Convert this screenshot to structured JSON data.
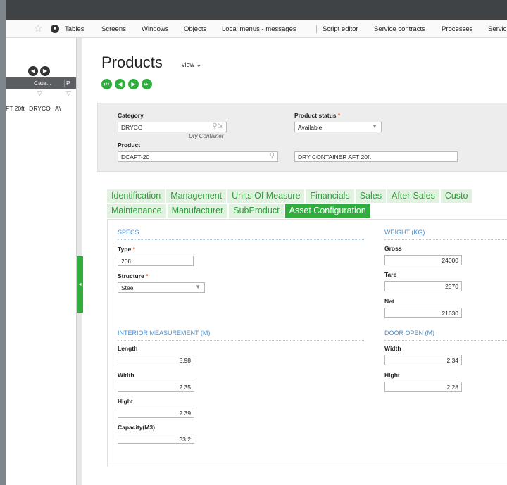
{
  "menu": {
    "items": [
      "Tables",
      "Screens",
      "Windows",
      "Objects",
      "Local menus - messages",
      "Script editor",
      "Service contracts",
      "Processes",
      "Servic"
    ]
  },
  "left_panel": {
    "columns": [
      "Cate...",
      "P"
    ],
    "row": {
      "col1": "FT 20ft",
      "col2": "DRYCO",
      "col3": "A\\"
    }
  },
  "page": {
    "title": "Products",
    "view_label": "view"
  },
  "header": {
    "category_label": "Category",
    "category_value": "DRYCO",
    "category_hint": "Dry Container",
    "product_status_label": "Product status",
    "product_status_value": "Available",
    "product_label": "Product",
    "product_value": "DCAFT-20",
    "product_description": "DRY CONTAINER AFT 20ft"
  },
  "tabs": {
    "row1": [
      "Identification",
      "Management",
      "Units Of Measure",
      "Financials",
      "Sales",
      "After-Sales",
      "Custo"
    ],
    "row2": [
      "Maintenance",
      "Manufacturer",
      "SubProduct",
      "Asset Configuration"
    ],
    "active": "Asset Configuration"
  },
  "specs": {
    "title": "SPECS",
    "type_label": "Type",
    "type_value": "20ft",
    "structure_label": "Structure",
    "structure_value": "Steel"
  },
  "weight": {
    "title": "WEIGHT (KG)",
    "gross_label": "Gross",
    "gross_value": "24000",
    "tare_label": "Tare",
    "tare_value": "2370",
    "net_label": "Net",
    "net_value": "21630"
  },
  "interior": {
    "title": "INTERIOR MEASUREMENT (M)",
    "length_label": "Length",
    "length_value": "5.98",
    "width_label": "Width",
    "width_value": "2.35",
    "hight_label": "Hight",
    "hight_value": "2.39",
    "capacity_label": "Capacity(M3)",
    "capacity_value": "33.2"
  },
  "door": {
    "title": "DOOR OPEN (M)",
    "width_label": "Width",
    "width_value": "2.34",
    "hight_label": "Hight",
    "hight_value": "2.28"
  },
  "colors": {
    "accent": "#2fae3e",
    "section_title": "#4a8fd1",
    "required": "#e86a1c",
    "titlebar": "#3f4346"
  }
}
